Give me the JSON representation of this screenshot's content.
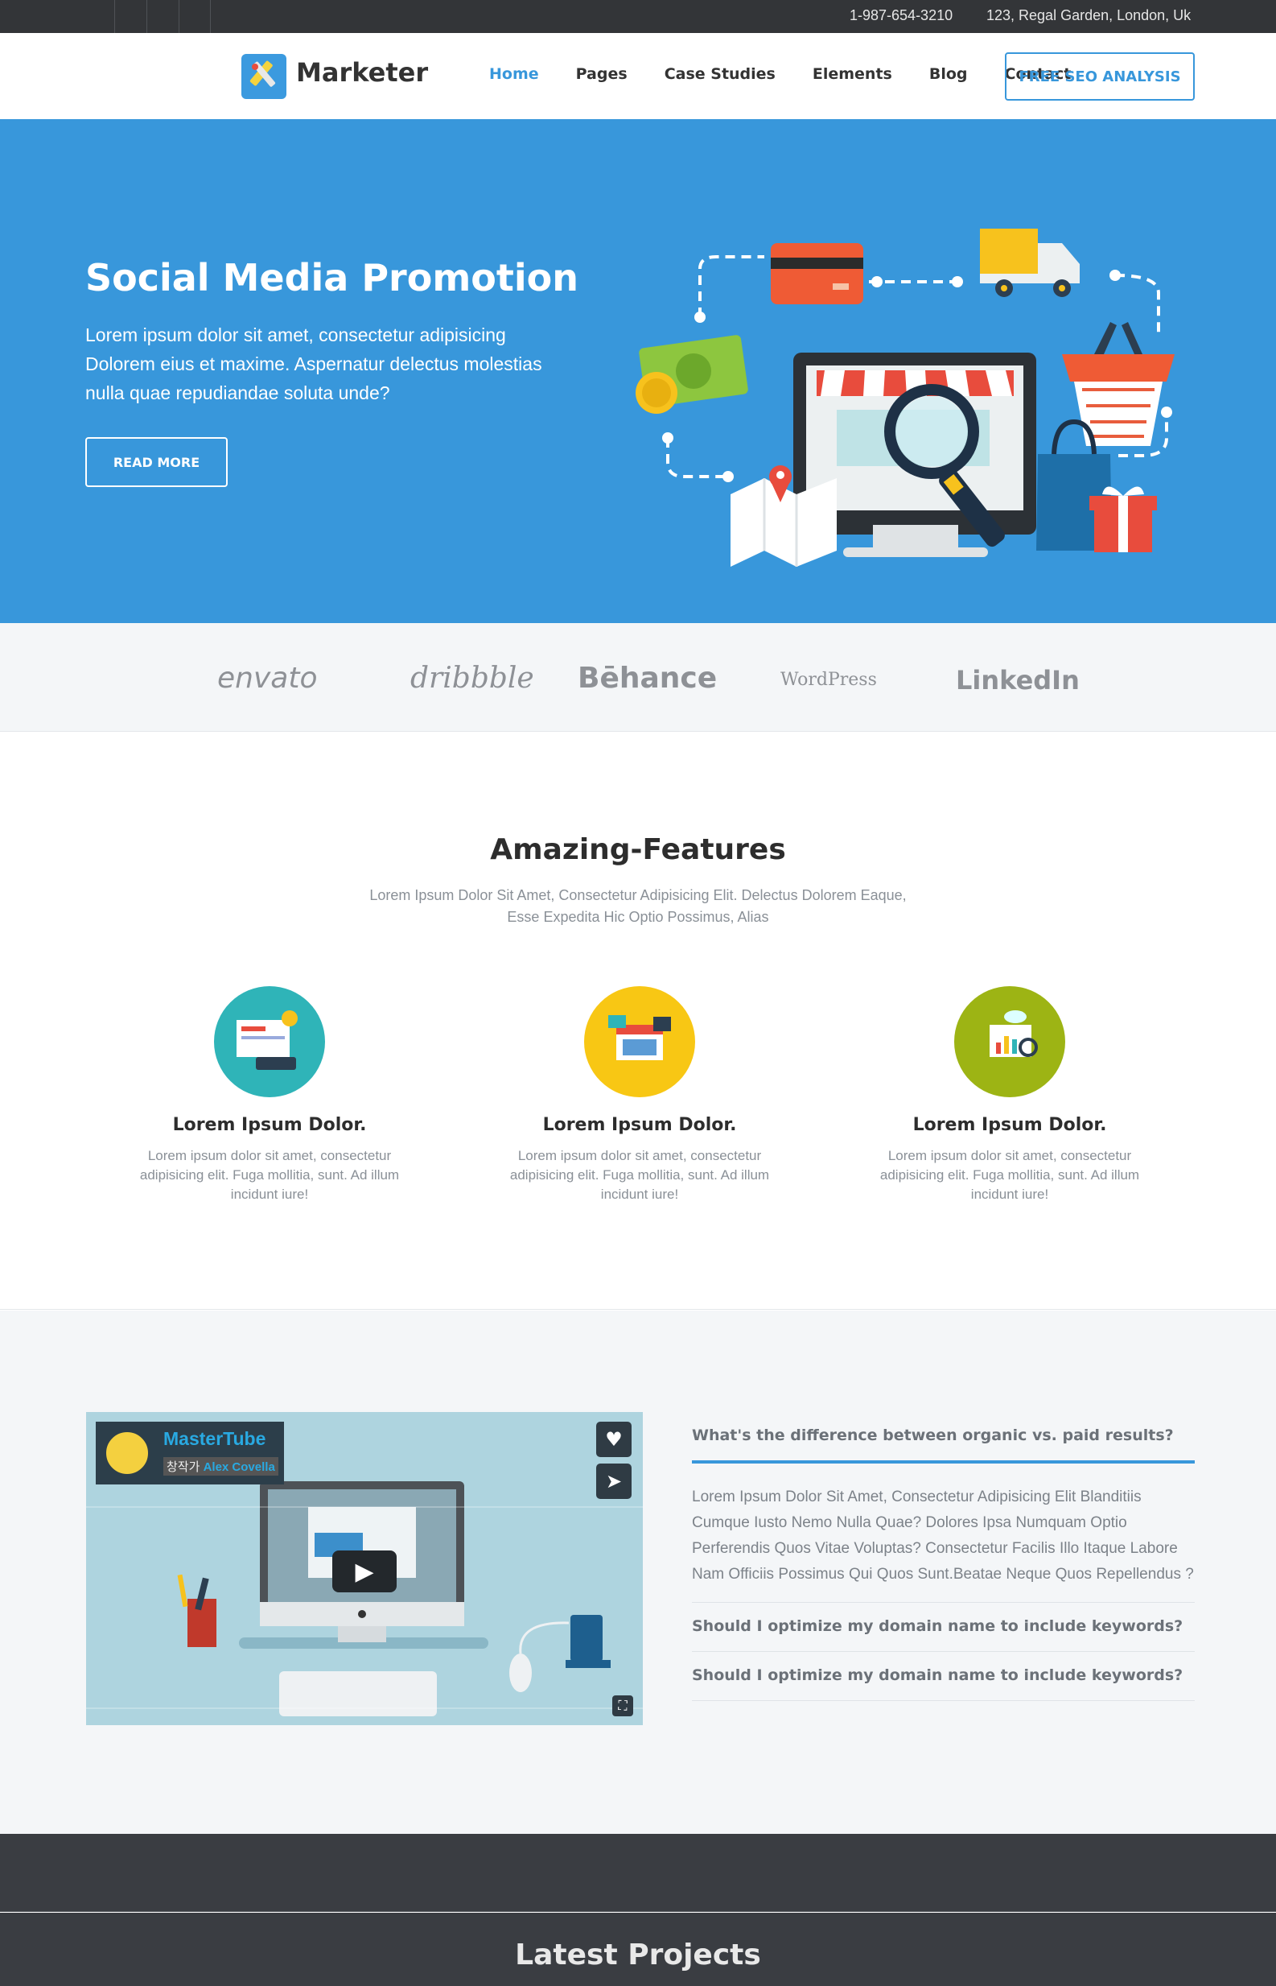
{
  "topbar": {
    "phone": "1-987-654-3210",
    "address": "123, Regal Garden, London, Uk"
  },
  "header": {
    "logo_text": "Marketer",
    "nav": [
      "Home",
      "Pages",
      "Case Studies",
      "Elements",
      "Blog",
      "Contact"
    ],
    "active_nav": "Home",
    "cta": "FREE SEO ANALYSIS"
  },
  "hero": {
    "title": "Social Media Promotion",
    "text": "Lorem ipsum dolor sit amet, consectetur adipisicing Dolorem eius et maxime. Aspernatur delectus molestias nulla quae repudiandae soluta unde?",
    "button": "READ MORE"
  },
  "brands": [
    "envato",
    "dribbble",
    "Bēhance",
    "WordPress",
    "LinkedIn"
  ],
  "features": {
    "title": "Amazing-Features",
    "subtitle": "Lorem Ipsum Dolor Sit Amet, Consectetur Adipisicing Elit. Delectus Dolorem Eaque, Esse Expedita Hic Optio Possimus, Alias",
    "items": [
      {
        "title": "Lorem Ipsum Dolor.",
        "text": "Lorem ipsum dolor sit amet, consectetur adipisicing elit. Fuga mollitia, sunt. Ad illum incidunt iure!",
        "color": "#2fb4b8"
      },
      {
        "title": "Lorem Ipsum Dolor.",
        "text": "Lorem ipsum dolor sit amet, consectetur adipisicing elit. Fuga mollitia, sunt. Ad illum incidunt iure!",
        "color": "#f8c714"
      },
      {
        "title": "Lorem Ipsum Dolor.",
        "text": "Lorem ipsum dolor sit amet, consectetur adipisicing elit. Fuga mollitia, sunt. Ad illum incidunt iure!",
        "color": "#9db414"
      }
    ]
  },
  "video": {
    "channel": "MasterTube",
    "author_prefix": "창작가",
    "author": "Alex Covella"
  },
  "faq": [
    {
      "question": "What's the difference between organic vs. paid results?",
      "answer": "Lorem Ipsum Dolor Sit Amet, Consectetur Adipisicing Elit Blanditiis Cumque Iusto Nemo Nulla Quae? Dolores Ipsa Numquam Optio Perferendis Quos Vitae Voluptas? Consectetur Facilis Illo Itaque Labore Nam Officiis Possimus Qui Quos Sunt.Beatae Neque Quos Repellendus ?"
    },
    {
      "question": "Should I optimize my domain name to include keywords?"
    },
    {
      "question": "Should I optimize my domain name to include keywords?"
    }
  ],
  "projects": {
    "title": "Latest Projects"
  },
  "colors": {
    "accent": "#3897db",
    "topbar": "#333538",
    "footer": "#3a3d42"
  }
}
